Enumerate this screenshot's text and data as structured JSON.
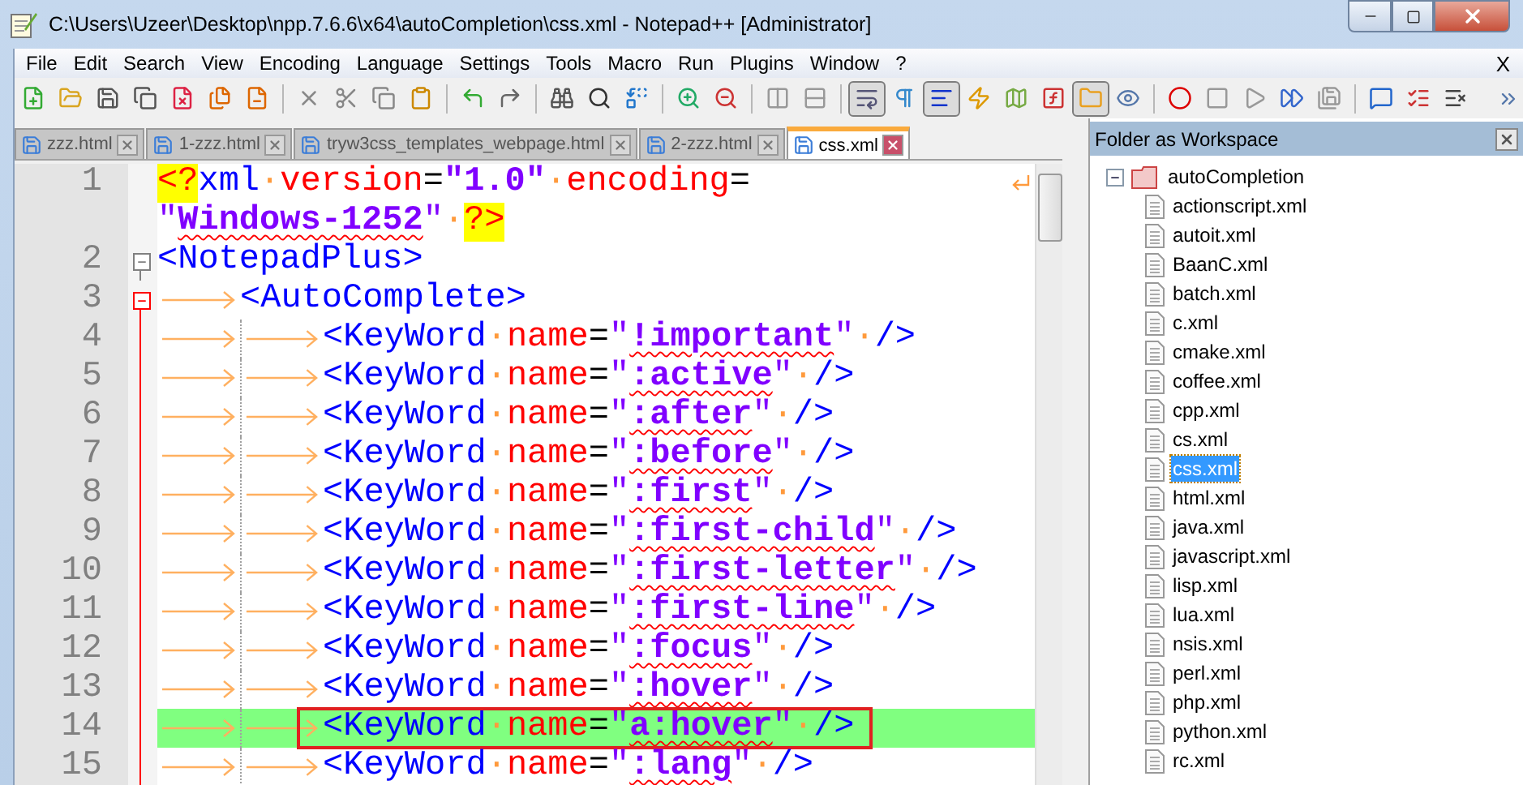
{
  "window": {
    "title": "C:\\Users\\Uzeer\\Desktop\\npp.7.6.6\\x64\\autoCompletion\\css.xml - Notepad++ [Administrator]"
  },
  "menu": [
    "File",
    "Edit",
    "Search",
    "View",
    "Encoding",
    "Language",
    "Settings",
    "Tools",
    "Macro",
    "Run",
    "Plugins",
    "Window",
    "?"
  ],
  "menu_close": "X",
  "toolbar": [
    [
      {
        "pressed": false
      },
      {
        "pressed": false
      },
      {
        "pressed": false
      },
      {
        "pressed": false
      },
      {
        "pressed": false
      },
      {
        "pressed": false
      },
      {
        "pressed": false
      }
    ],
    [
      {
        "pressed": false
      },
      {
        "pressed": false
      },
      {
        "pressed": false
      },
      {
        "pressed": false
      }
    ],
    [
      {
        "pressed": false
      },
      {
        "pressed": false
      }
    ],
    [
      {
        "pressed": false
      },
      {
        "pressed": false
      },
      {
        "pressed": false
      }
    ],
    [
      {
        "pressed": false
      },
      {
        "pressed": false
      }
    ],
    [
      {
        "pressed": false
      },
      {
        "pressed": false
      }
    ],
    [
      {
        "pressed": true
      },
      {
        "pressed": false
      },
      {
        "pressed": true
      },
      {
        "pressed": false
      },
      {
        "pressed": false
      },
      {
        "pressed": false
      },
      {
        "pressed": true
      },
      {
        "pressed": false
      }
    ],
    [
      {
        "pressed": false
      },
      {
        "pressed": false
      },
      {
        "pressed": false
      },
      {
        "pressed": false
      },
      {
        "pressed": false
      }
    ],
    [
      {
        "pressed": false
      },
      {
        "pressed": false
      },
      {
        "pressed": false
      }
    ]
  ],
  "tabs": [
    {
      "label": "zzz.html",
      "selected": false
    },
    {
      "label": "1-zzz.html",
      "selected": false
    },
    {
      "label": "tryw3css_templates_webpage.html",
      "selected": false
    },
    {
      "label": "2-zzz.html",
      "selected": false
    },
    {
      "label": "css.xml",
      "selected": true
    }
  ],
  "editor": {
    "lines": [
      {
        "number": "1",
        "fold_marker": false,
        "fold_range": false,
        "highlighted": false,
        "boxed": false,
        "segments": [
          {
            "kind": "pi",
            "text": "<?"
          },
          {
            "kind": "tag",
            "text": "xml"
          },
          {
            "kind": "space",
            "text": "·"
          },
          {
            "kind": "attr",
            "text": "version"
          },
          {
            "kind": "punct",
            "text": "="
          },
          {
            "kind": "string",
            "text": "\"1.0\""
          },
          {
            "kind": "space",
            "text": "·"
          },
          {
            "kind": "attr",
            "text": "encoding"
          },
          {
            "kind": "punct",
            "text": "="
          }
        ],
        "wrap": [
          {
            "kind": "quote",
            "text": "\""
          },
          {
            "kind": "value",
            "text": "Windows-1252"
          },
          {
            "kind": "quote",
            "text": "\""
          },
          {
            "kind": "space",
            "text": "·"
          },
          {
            "kind": "pi",
            "text": "?>"
          }
        ]
      },
      {
        "number": "2",
        "fold_marker": true,
        "fold_active": false,
        "fold_range": false,
        "highlighted": false,
        "boxed": false,
        "segments": [
          {
            "kind": "tag",
            "text": "<NotepadPlus>"
          }
        ]
      },
      {
        "number": "3",
        "fold_marker": true,
        "fold_active": true,
        "fold_range": false,
        "highlighted": false,
        "boxed": false,
        "segments": [
          {
            "kind": "tab"
          },
          {
            "kind": "tag",
            "text": "<AutoComplete>"
          }
        ]
      },
      {
        "number": "4",
        "fold_marker": false,
        "fold_active": true,
        "fold_range": true,
        "highlighted": false,
        "boxed": false,
        "segments": [
          {
            "kind": "tab"
          },
          {
            "kind": "guided-tab"
          },
          {
            "kind": "tag",
            "text": "<KeyWord"
          },
          {
            "kind": "space",
            "text": "·"
          },
          {
            "kind": "attr",
            "text": "name"
          },
          {
            "kind": "punct",
            "text": "="
          },
          {
            "kind": "quote",
            "text": "\""
          },
          {
            "kind": "value",
            "text": "!important"
          },
          {
            "kind": "quote",
            "text": "\""
          },
          {
            "kind": "space",
            "text": "·"
          },
          {
            "kind": "tag",
            "text": "/>"
          }
        ]
      },
      {
        "number": "5",
        "fold_marker": false,
        "fold_active": true,
        "fold_range": true,
        "highlighted": false,
        "boxed": false,
        "segments": [
          {
            "kind": "tab"
          },
          {
            "kind": "guided-tab"
          },
          {
            "kind": "tag",
            "text": "<KeyWord"
          },
          {
            "kind": "space",
            "text": "·"
          },
          {
            "kind": "attr",
            "text": "name"
          },
          {
            "kind": "punct",
            "text": "="
          },
          {
            "kind": "quote",
            "text": "\""
          },
          {
            "kind": "value",
            "text": ":active"
          },
          {
            "kind": "quote",
            "text": "\""
          },
          {
            "kind": "space",
            "text": "·"
          },
          {
            "kind": "tag",
            "text": "/>"
          }
        ]
      },
      {
        "number": "6",
        "fold_marker": false,
        "fold_active": true,
        "fold_range": true,
        "highlighted": false,
        "boxed": false,
        "segments": [
          {
            "kind": "tab"
          },
          {
            "kind": "guided-tab"
          },
          {
            "kind": "tag",
            "text": "<KeyWord"
          },
          {
            "kind": "space",
            "text": "·"
          },
          {
            "kind": "attr",
            "text": "name"
          },
          {
            "kind": "punct",
            "text": "="
          },
          {
            "kind": "quote",
            "text": "\""
          },
          {
            "kind": "value",
            "text": ":after"
          },
          {
            "kind": "quote",
            "text": "\""
          },
          {
            "kind": "space",
            "text": "·"
          },
          {
            "kind": "tag",
            "text": "/>"
          }
        ]
      },
      {
        "number": "7",
        "fold_marker": false,
        "fold_active": true,
        "fold_range": true,
        "highlighted": false,
        "boxed": false,
        "segments": [
          {
            "kind": "tab"
          },
          {
            "kind": "guided-tab"
          },
          {
            "kind": "tag",
            "text": "<KeyWord"
          },
          {
            "kind": "space",
            "text": "·"
          },
          {
            "kind": "attr",
            "text": "name"
          },
          {
            "kind": "punct",
            "text": "="
          },
          {
            "kind": "quote",
            "text": "\""
          },
          {
            "kind": "value",
            "text": ":before"
          },
          {
            "kind": "quote",
            "text": "\""
          },
          {
            "kind": "space",
            "text": "·"
          },
          {
            "kind": "tag",
            "text": "/>"
          }
        ]
      },
      {
        "number": "8",
        "fold_marker": false,
        "fold_active": true,
        "fold_range": true,
        "highlighted": false,
        "boxed": false,
        "segments": [
          {
            "kind": "tab"
          },
          {
            "kind": "guided-tab"
          },
          {
            "kind": "tag",
            "text": "<KeyWord"
          },
          {
            "kind": "space",
            "text": "·"
          },
          {
            "kind": "attr",
            "text": "name"
          },
          {
            "kind": "punct",
            "text": "="
          },
          {
            "kind": "quote",
            "text": "\""
          },
          {
            "kind": "value",
            "text": ":first"
          },
          {
            "kind": "quote",
            "text": "\""
          },
          {
            "kind": "space",
            "text": "·"
          },
          {
            "kind": "tag",
            "text": "/>"
          }
        ]
      },
      {
        "number": "9",
        "fold_marker": false,
        "fold_active": true,
        "fold_range": true,
        "highlighted": false,
        "boxed": false,
        "segments": [
          {
            "kind": "tab"
          },
          {
            "kind": "guided-tab"
          },
          {
            "kind": "tag",
            "text": "<KeyWord"
          },
          {
            "kind": "space",
            "text": "·"
          },
          {
            "kind": "attr",
            "text": "name"
          },
          {
            "kind": "punct",
            "text": "="
          },
          {
            "kind": "quote",
            "text": "\""
          },
          {
            "kind": "value",
            "text": ":first-child"
          },
          {
            "kind": "quote",
            "text": "\""
          },
          {
            "kind": "space",
            "text": "·"
          },
          {
            "kind": "tag",
            "text": "/>"
          }
        ]
      },
      {
        "number": "10",
        "fold_marker": false,
        "fold_active": true,
        "fold_range": true,
        "highlighted": false,
        "boxed": false,
        "segments": [
          {
            "kind": "tab"
          },
          {
            "kind": "guided-tab"
          },
          {
            "kind": "tag",
            "text": "<KeyWord"
          },
          {
            "kind": "space",
            "text": "·"
          },
          {
            "kind": "attr",
            "text": "name"
          },
          {
            "kind": "punct",
            "text": "="
          },
          {
            "kind": "quote",
            "text": "\""
          },
          {
            "kind": "value",
            "text": ":first-letter"
          },
          {
            "kind": "quote",
            "text": "\""
          },
          {
            "kind": "space",
            "text": "·"
          },
          {
            "kind": "tag",
            "text": "/>"
          }
        ]
      },
      {
        "number": "11",
        "fold_marker": false,
        "fold_active": true,
        "fold_range": true,
        "highlighted": false,
        "boxed": false,
        "segments": [
          {
            "kind": "tab"
          },
          {
            "kind": "guided-tab"
          },
          {
            "kind": "tag",
            "text": "<KeyWord"
          },
          {
            "kind": "space",
            "text": "·"
          },
          {
            "kind": "attr",
            "text": "name"
          },
          {
            "kind": "punct",
            "text": "="
          },
          {
            "kind": "quote",
            "text": "\""
          },
          {
            "kind": "value",
            "text": ":first-line"
          },
          {
            "kind": "quote",
            "text": "\""
          },
          {
            "kind": "space",
            "text": "·"
          },
          {
            "kind": "tag",
            "text": "/>"
          }
        ]
      },
      {
        "number": "12",
        "fold_marker": false,
        "fold_active": true,
        "fold_range": true,
        "highlighted": false,
        "boxed": false,
        "segments": [
          {
            "kind": "tab"
          },
          {
            "kind": "guided-tab"
          },
          {
            "kind": "tag",
            "text": "<KeyWord"
          },
          {
            "kind": "space",
            "text": "·"
          },
          {
            "kind": "attr",
            "text": "name"
          },
          {
            "kind": "punct",
            "text": "="
          },
          {
            "kind": "quote",
            "text": "\""
          },
          {
            "kind": "value",
            "text": ":focus"
          },
          {
            "kind": "quote",
            "text": "\""
          },
          {
            "kind": "space",
            "text": "·"
          },
          {
            "kind": "tag",
            "text": "/>"
          }
        ]
      },
      {
        "number": "13",
        "fold_marker": false,
        "fold_active": true,
        "fold_range": true,
        "highlighted": false,
        "boxed": false,
        "segments": [
          {
            "kind": "tab"
          },
          {
            "kind": "guided-tab"
          },
          {
            "kind": "tag",
            "text": "<KeyWord"
          },
          {
            "kind": "space",
            "text": "·"
          },
          {
            "kind": "attr",
            "text": "name"
          },
          {
            "kind": "punct",
            "text": "="
          },
          {
            "kind": "quote",
            "text": "\""
          },
          {
            "kind": "value",
            "text": ":hover"
          },
          {
            "kind": "quote",
            "text": "\""
          },
          {
            "kind": "space",
            "text": "·"
          },
          {
            "kind": "tag",
            "text": "/>"
          }
        ]
      },
      {
        "number": "14",
        "fold_marker": false,
        "fold_active": true,
        "fold_range": true,
        "highlighted": true,
        "boxed": true,
        "segments": [
          {
            "kind": "tab"
          },
          {
            "kind": "guided-tab"
          },
          {
            "kind": "tag",
            "text": "<KeyWord"
          },
          {
            "kind": "space",
            "text": "·"
          },
          {
            "kind": "attr",
            "text": "name"
          },
          {
            "kind": "punct",
            "text": "="
          },
          {
            "kind": "quote",
            "text": "\""
          },
          {
            "kind": "value",
            "text": "a:hover"
          },
          {
            "kind": "quote",
            "text": "\""
          },
          {
            "kind": "space",
            "text": "·"
          },
          {
            "kind": "tag",
            "text": "/>"
          }
        ]
      },
      {
        "number": "15",
        "fold_marker": false,
        "fold_active": true,
        "fold_range": true,
        "highlighted": false,
        "boxed": false,
        "segments": [
          {
            "kind": "tab"
          },
          {
            "kind": "guided-tab"
          },
          {
            "kind": "tag",
            "text": "<KeyWord"
          },
          {
            "kind": "space",
            "text": "·"
          },
          {
            "kind": "attr",
            "text": "name"
          },
          {
            "kind": "punct",
            "text": "="
          },
          {
            "kind": "quote",
            "text": "\""
          },
          {
            "kind": "value",
            "text": ":lang"
          },
          {
            "kind": "quote",
            "text": "\""
          },
          {
            "kind": "space",
            "text": "·"
          },
          {
            "kind": "tag",
            "text": "/>"
          }
        ]
      }
    ]
  },
  "workspace": {
    "title": "Folder as Workspace",
    "tree": [
      {
        "label": "autoCompletion",
        "expanded": true,
        "selected": false,
        "children": [
          {
            "label": "actionscript.xml",
            "selected": false
          },
          {
            "label": "autoit.xml",
            "selected": false
          },
          {
            "label": "BaanC.xml",
            "selected": false
          },
          {
            "label": "batch.xml",
            "selected": false
          },
          {
            "label": "c.xml",
            "selected": false
          },
          {
            "label": "cmake.xml",
            "selected": false
          },
          {
            "label": "coffee.xml",
            "selected": false
          },
          {
            "label": "cpp.xml",
            "selected": false
          },
          {
            "label": "cs.xml",
            "selected": false
          },
          {
            "label": "css.xml",
            "selected": true
          },
          {
            "label": "html.xml",
            "selected": false
          },
          {
            "label": "java.xml",
            "selected": false
          },
          {
            "label": "javascript.xml",
            "selected": false
          },
          {
            "label": "lisp.xml",
            "selected": false
          },
          {
            "label": "lua.xml",
            "selected": false
          },
          {
            "label": "nsis.xml",
            "selected": false
          },
          {
            "label": "perl.xml",
            "selected": false
          },
          {
            "label": "php.xml",
            "selected": false
          },
          {
            "label": "python.xml",
            "selected": false
          },
          {
            "label": "rc.xml",
            "selected": false
          }
        ]
      }
    ]
  }
}
